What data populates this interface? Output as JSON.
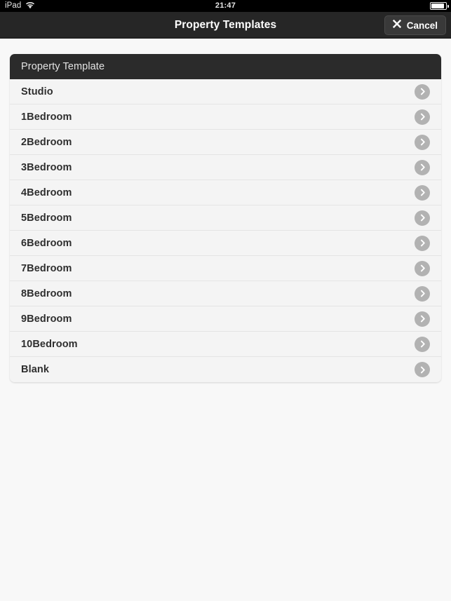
{
  "status_bar": {
    "carrier": "iPad",
    "wifi_icon": "wifi-icon",
    "time": "21:47",
    "battery_icon": "battery-icon"
  },
  "navbar": {
    "title": "Property Templates",
    "cancel": {
      "label": "Cancel",
      "icon": "close-x-icon"
    }
  },
  "panel": {
    "header": "Property Template",
    "row_icon": "chevron-right-icon",
    "rows": [
      {
        "label": "Studio"
      },
      {
        "label": "1Bedroom"
      },
      {
        "label": "2Bedroom"
      },
      {
        "label": "3Bedroom"
      },
      {
        "label": "4Bedroom"
      },
      {
        "label": "5Bedroom"
      },
      {
        "label": "6Bedroom"
      },
      {
        "label": "7Bedroom"
      },
      {
        "label": "8Bedroom"
      },
      {
        "label": "9Bedroom"
      },
      {
        "label": "10Bedroom"
      },
      {
        "label": "Blank"
      }
    ]
  },
  "colors": {
    "status_bar_bg": "#000000",
    "navbar_bg": "#262626",
    "panel_header_bg": "#2b2b2b",
    "row_bg": "#f4f4f4",
    "page_bg": "#f8f8f8",
    "disclosure": "#b2b2b2"
  }
}
